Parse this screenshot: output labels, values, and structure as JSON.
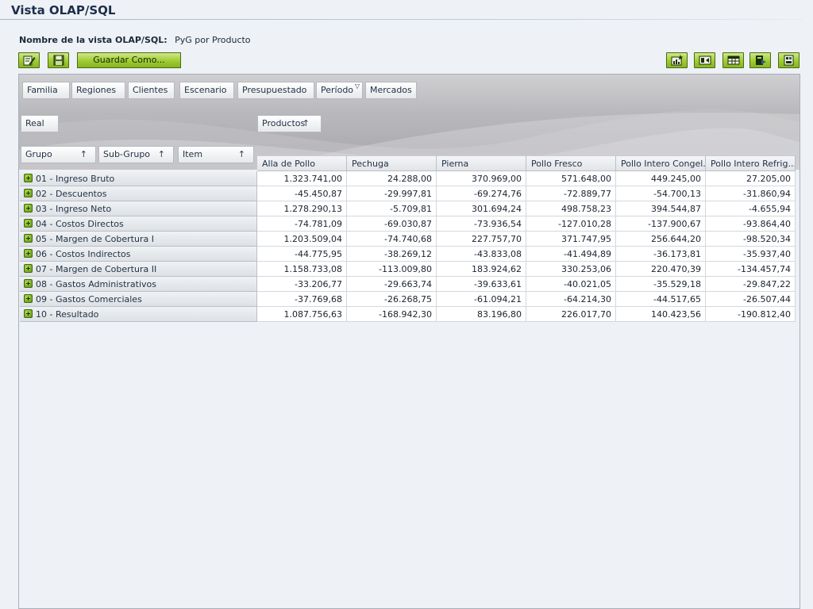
{
  "title": "Vista OLAP/SQL",
  "view_name": {
    "label": "Nombre de la vista OLAP/SQL:",
    "value": "PyG por Producto"
  },
  "toolbar": {
    "save_as_label": "Guardar Como...",
    "left_icons": [
      "edit-icon",
      "save-icon"
    ],
    "right_icons": [
      "add-chart-icon",
      "swap-axes-icon",
      "table-view-icon",
      "export-icon",
      "settings-icon"
    ]
  },
  "filter_dimensions": [
    "Familia",
    "Regiones",
    "Clientes",
    "Escenario",
    "Presupuestado",
    "Período",
    "Mercados"
  ],
  "active_filter": "Período",
  "scenario_dimension": "Real",
  "column_dimension": "Productos",
  "row_dimensions": [
    "Grupo",
    "Sub-Grupo",
    "Item"
  ],
  "columns": [
    "Alla de Pollo",
    "Pechuga",
    "Pierna",
    "Pollo Fresco",
    "Pollo Intero Congel...",
    "Pollo Intero Refrig..."
  ],
  "rows": [
    {
      "label": "01 - Ingreso Bruto",
      "values": [
        "1.323.741,00",
        "24.288,00",
        "370.969,00",
        "571.648,00",
        "449.245,00",
        "27.205,00"
      ]
    },
    {
      "label": "02 - Descuentos",
      "values": [
        "-45.450,87",
        "-29.997,81",
        "-69.274,76",
        "-72.889,77",
        "-54.700,13",
        "-31.860,94"
      ]
    },
    {
      "label": "03 - Ingreso Neto",
      "values": [
        "1.278.290,13",
        "-5.709,81",
        "301.694,24",
        "498.758,23",
        "394.544,87",
        "-4.655,94"
      ]
    },
    {
      "label": "04 - Costos Directos",
      "values": [
        "-74.781,09",
        "-69.030,87",
        "-73.936,54",
        "-127.010,28",
        "-137.900,67",
        "-93.864,40"
      ]
    },
    {
      "label": "05 - Margen de Cobertura I",
      "values": [
        "1.203.509,04",
        "-74.740,68",
        "227.757,70",
        "371.747,95",
        "256.644,20",
        "-98.520,34"
      ]
    },
    {
      "label": "06 - Costos Indirectos",
      "values": [
        "-44.775,95",
        "-38.269,12",
        "-43.833,08",
        "-41.494,89",
        "-36.173,81",
        "-35.937,40"
      ]
    },
    {
      "label": "07 - Margen de Cobertura II",
      "values": [
        "1.158.733,08",
        "-113.009,80",
        "183.924,62",
        "330.253,06",
        "220.470,39",
        "-134.457,74"
      ]
    },
    {
      "label": "08 - Gastos Administrativos",
      "values": [
        "-33.206,77",
        "-29.663,74",
        "-39.633,61",
        "-40.021,05",
        "-35.529,18",
        "-29.847,22"
      ]
    },
    {
      "label": "09 - Gastos Comerciales",
      "values": [
        "-37.769,68",
        "-26.268,75",
        "-61.094,21",
        "-64.214,30",
        "-44.517,65",
        "-26.507,44"
      ]
    },
    {
      "label": "10 - Resultado",
      "values": [
        "1.087.756,63",
        "-168.942,30",
        "83.196,80",
        "226.017,70",
        "140.423,56",
        "-190.812,40"
      ]
    }
  ]
}
